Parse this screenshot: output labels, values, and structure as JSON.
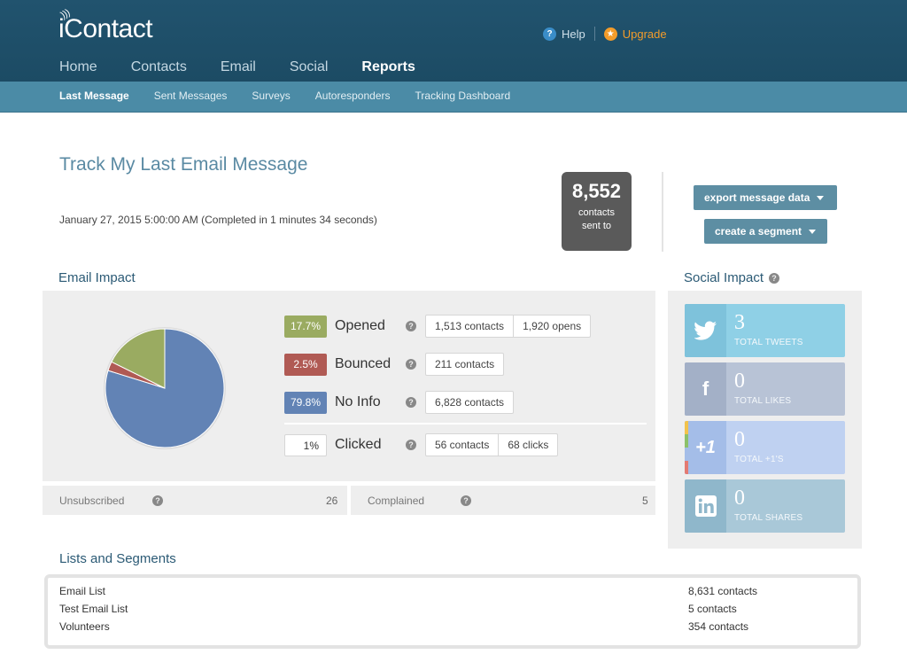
{
  "app": {
    "logo_text": "iContact"
  },
  "header": {
    "help_label": "Help",
    "upgrade_label": "Upgrade"
  },
  "nav": {
    "items": [
      "Home",
      "Contacts",
      "Email",
      "Social",
      "Reports"
    ],
    "active": "Reports"
  },
  "subnav": {
    "items": [
      "Last Message",
      "Sent Messages",
      "Surveys",
      "Autoresponders",
      "Tracking Dashboard"
    ],
    "active": "Last Message"
  },
  "page": {
    "title": "Track My Last Email Message",
    "sent_date": "January 27, 2015 5:00:00 AM (Completed in 1 minutes 34 seconds)"
  },
  "sent_summary": {
    "count": "8,552",
    "label_line1": "contacts",
    "label_line2": "sent to"
  },
  "actions": {
    "export_label": "export message data",
    "segment_label": "create a segment"
  },
  "email_impact": {
    "title": "Email Impact",
    "metrics": [
      {
        "percent": "17.7%",
        "label": "Opened",
        "contacts": "1,513 contacts",
        "extra": "1,920 opens",
        "color": "#9aab61"
      },
      {
        "percent": "2.5%",
        "label": "Bounced",
        "contacts": "211 contacts",
        "extra": "",
        "color": "#b05a54"
      },
      {
        "percent": "79.8%",
        "label": "No Info",
        "contacts": "6,828 contacts",
        "extra": "",
        "color": "#6283b5"
      },
      {
        "percent": "1%",
        "label": "Clicked",
        "contacts": "56 contacts",
        "extra": "68 clicks",
        "color": "#ffffff"
      }
    ],
    "pie": {
      "opened": 17.7,
      "bounced": 2.5,
      "no_info": 79.8
    },
    "unsubscribed": {
      "label": "Unsubscribed",
      "value": "26"
    },
    "complained": {
      "label": "Complained",
      "value": "5"
    }
  },
  "social_impact": {
    "title": "Social Impact",
    "cards": [
      {
        "icon": "twitter-icon",
        "count": "3",
        "caption": "TOTAL TWEETS",
        "color": "#8fd0e6",
        "icon_bg": "#7ec2db"
      },
      {
        "icon": "facebook-icon",
        "count": "0",
        "caption": "TOTAL LIKES",
        "color": "#b8c3d6",
        "icon_bg": "#a3b0c7"
      },
      {
        "icon": "google-plus-icon",
        "count": "0",
        "caption": "TOTAL +1'S",
        "color": "#bfd1f1",
        "icon_bg": "#a4bde8"
      },
      {
        "icon": "linkedin-icon",
        "count": "0",
        "caption": "TOTAL SHARES",
        "color": "#a9c8d8",
        "icon_bg": "#8fb7cb"
      }
    ]
  },
  "lists": {
    "title": "Lists and Segments",
    "rows": [
      {
        "name": "Email List",
        "count": "8,631 contacts"
      },
      {
        "name": "Test Email List",
        "count": "5 contacts"
      },
      {
        "name": "Volunteers",
        "count": "354 contacts"
      }
    ]
  }
}
